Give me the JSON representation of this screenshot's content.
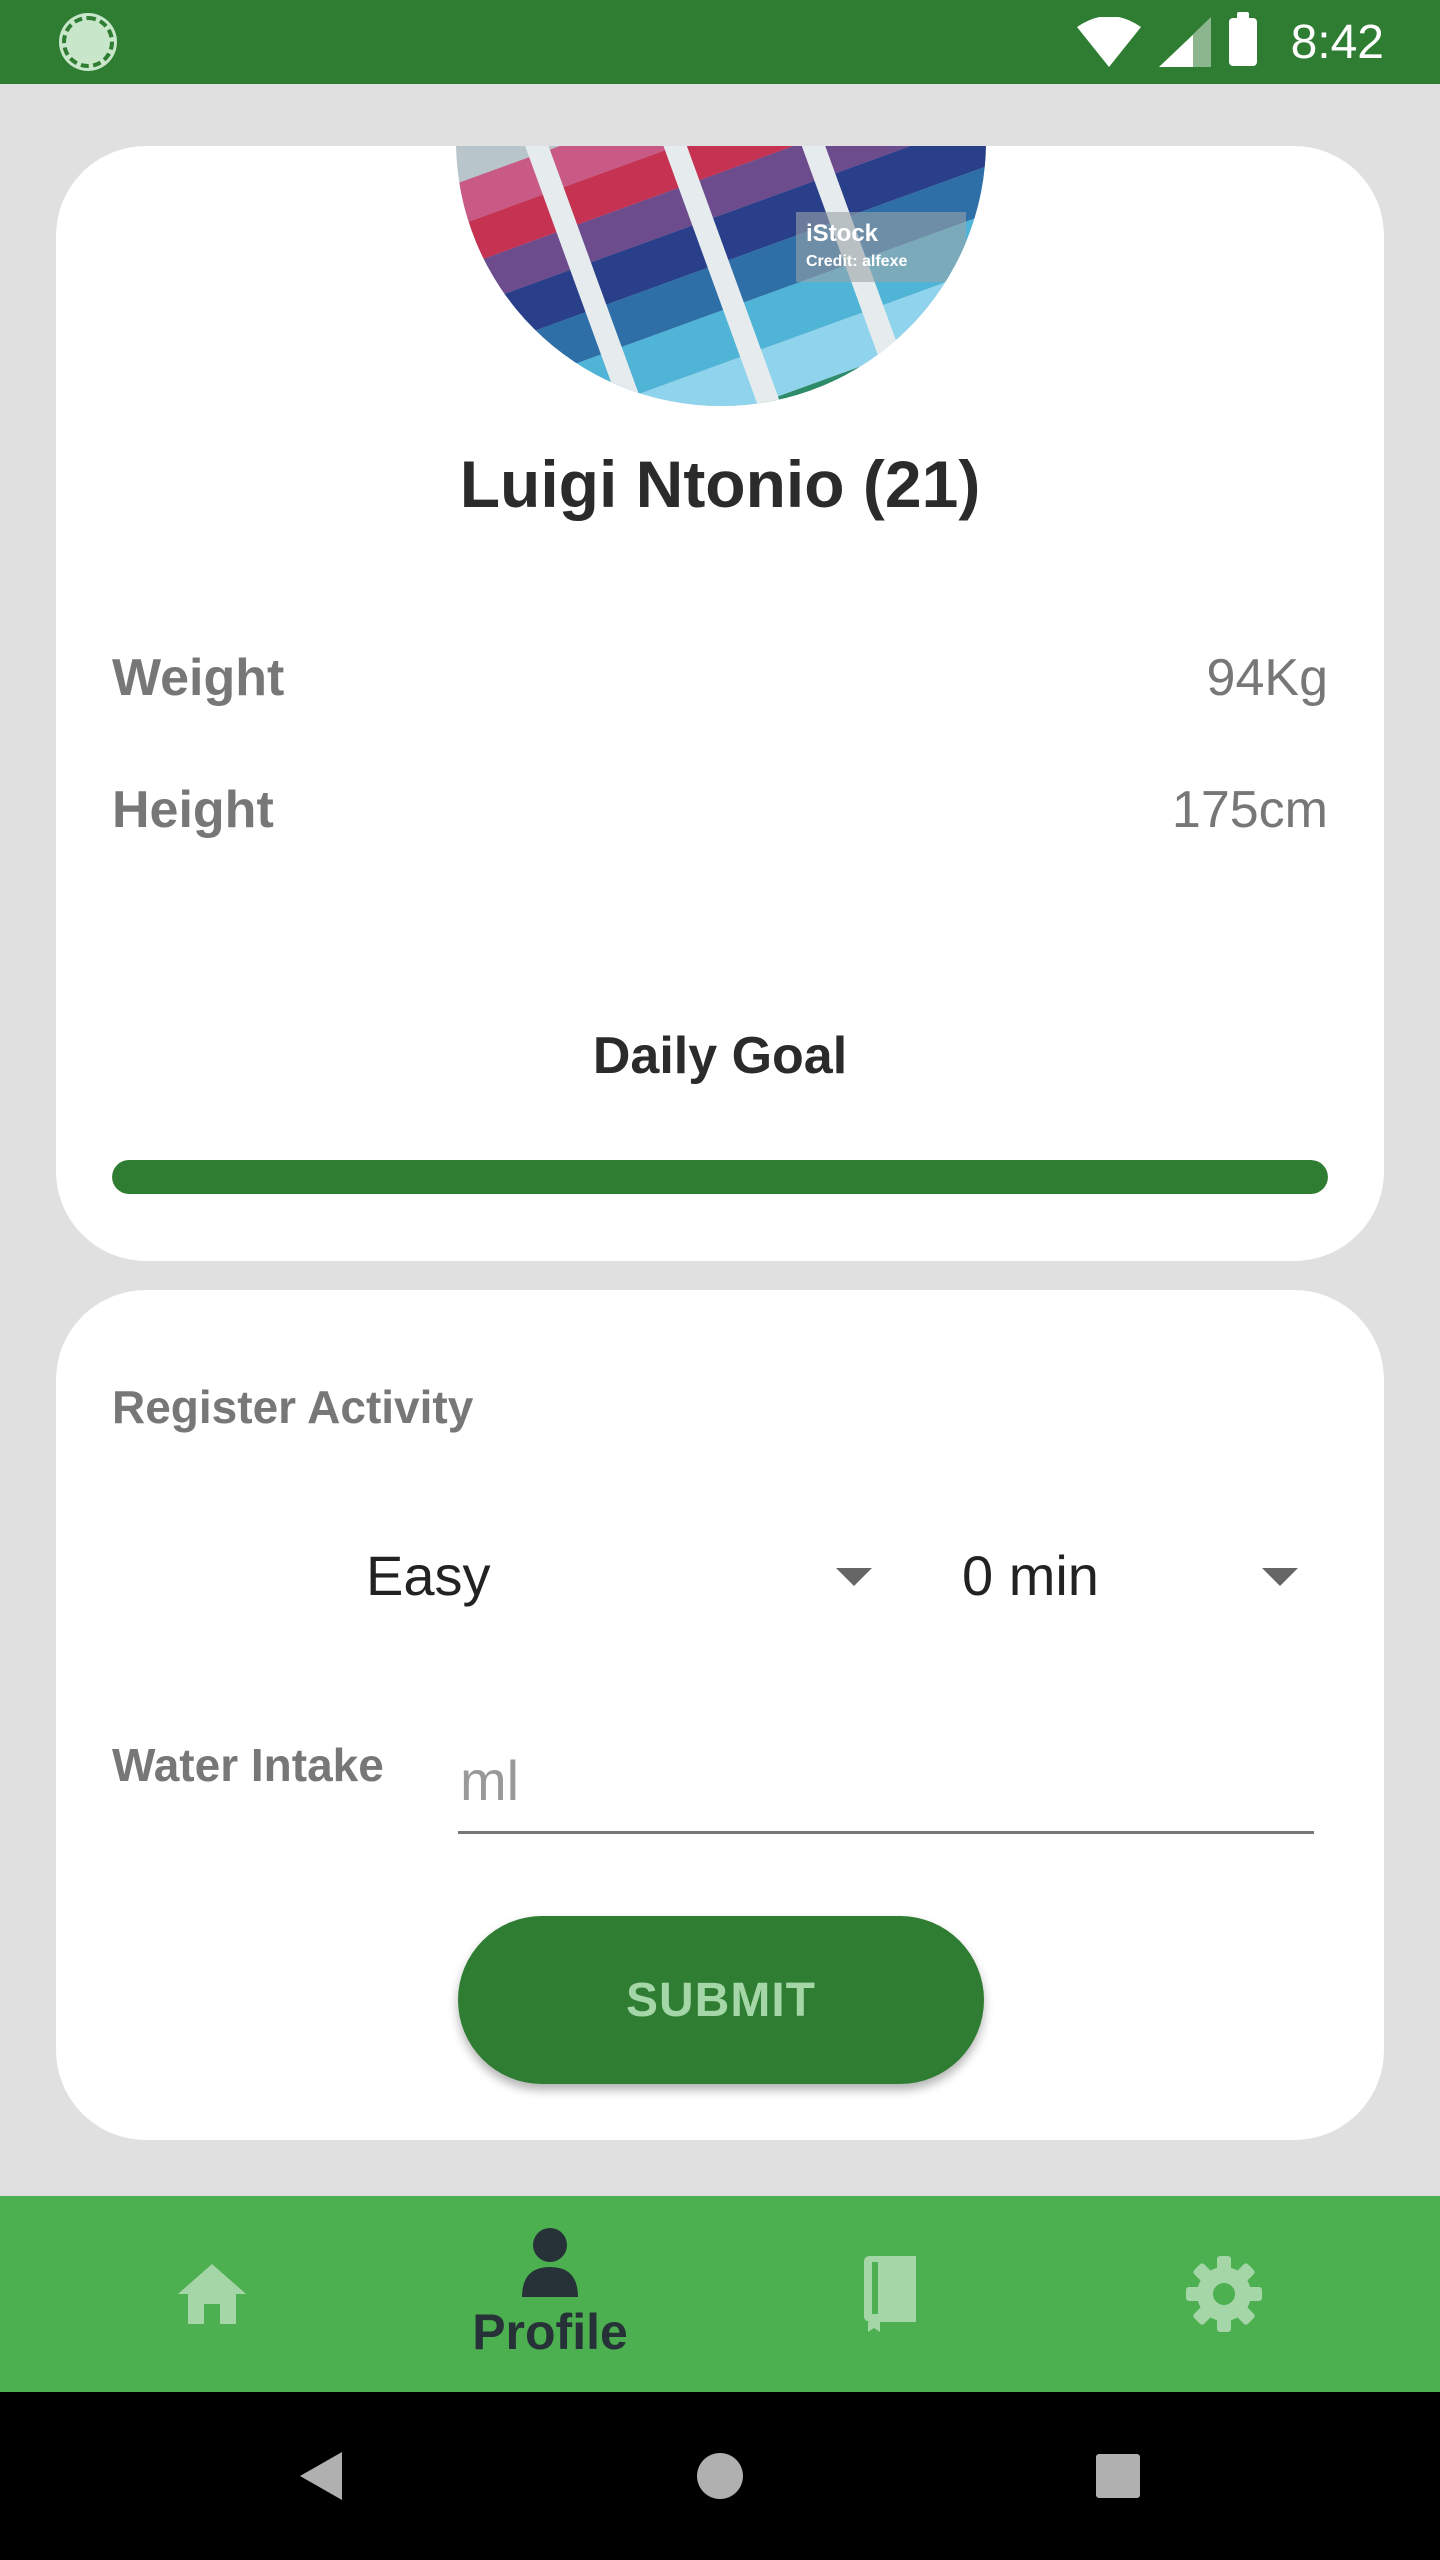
{
  "status_bar": {
    "time": "8:42"
  },
  "profile": {
    "name": "Luigi Ntonio (21)",
    "photo_watermark": "iStock",
    "photo_credit": "Credit: alfexe",
    "stats": [
      {
        "label": "Weight",
        "value": "94Kg"
      },
      {
        "label": "Height",
        "value": "175cm"
      }
    ],
    "daily_goal": {
      "title": "Daily Goal",
      "progress_fraction": 1.0
    }
  },
  "activity": {
    "title": "Register Activity",
    "difficulty": {
      "selected": "Easy"
    },
    "duration": {
      "selected": "0 min"
    },
    "water": {
      "label": "Water Intake",
      "placeholder": "ml",
      "value": ""
    },
    "submit_label": "SUBMIT"
  },
  "bottom_nav": {
    "active": "profile",
    "items": [
      {
        "id": "home",
        "icon": "home-icon",
        "label": ""
      },
      {
        "id": "profile",
        "icon": "person-icon",
        "label": "Profile"
      },
      {
        "id": "diary",
        "icon": "book-icon",
        "label": ""
      },
      {
        "id": "settings",
        "icon": "gear-icon",
        "label": ""
      }
    ]
  },
  "colors": {
    "primary_dark": "#2e7d32",
    "primary": "#4caf50",
    "button_text": "#a5d6a7",
    "background": "#e0e0e0"
  }
}
